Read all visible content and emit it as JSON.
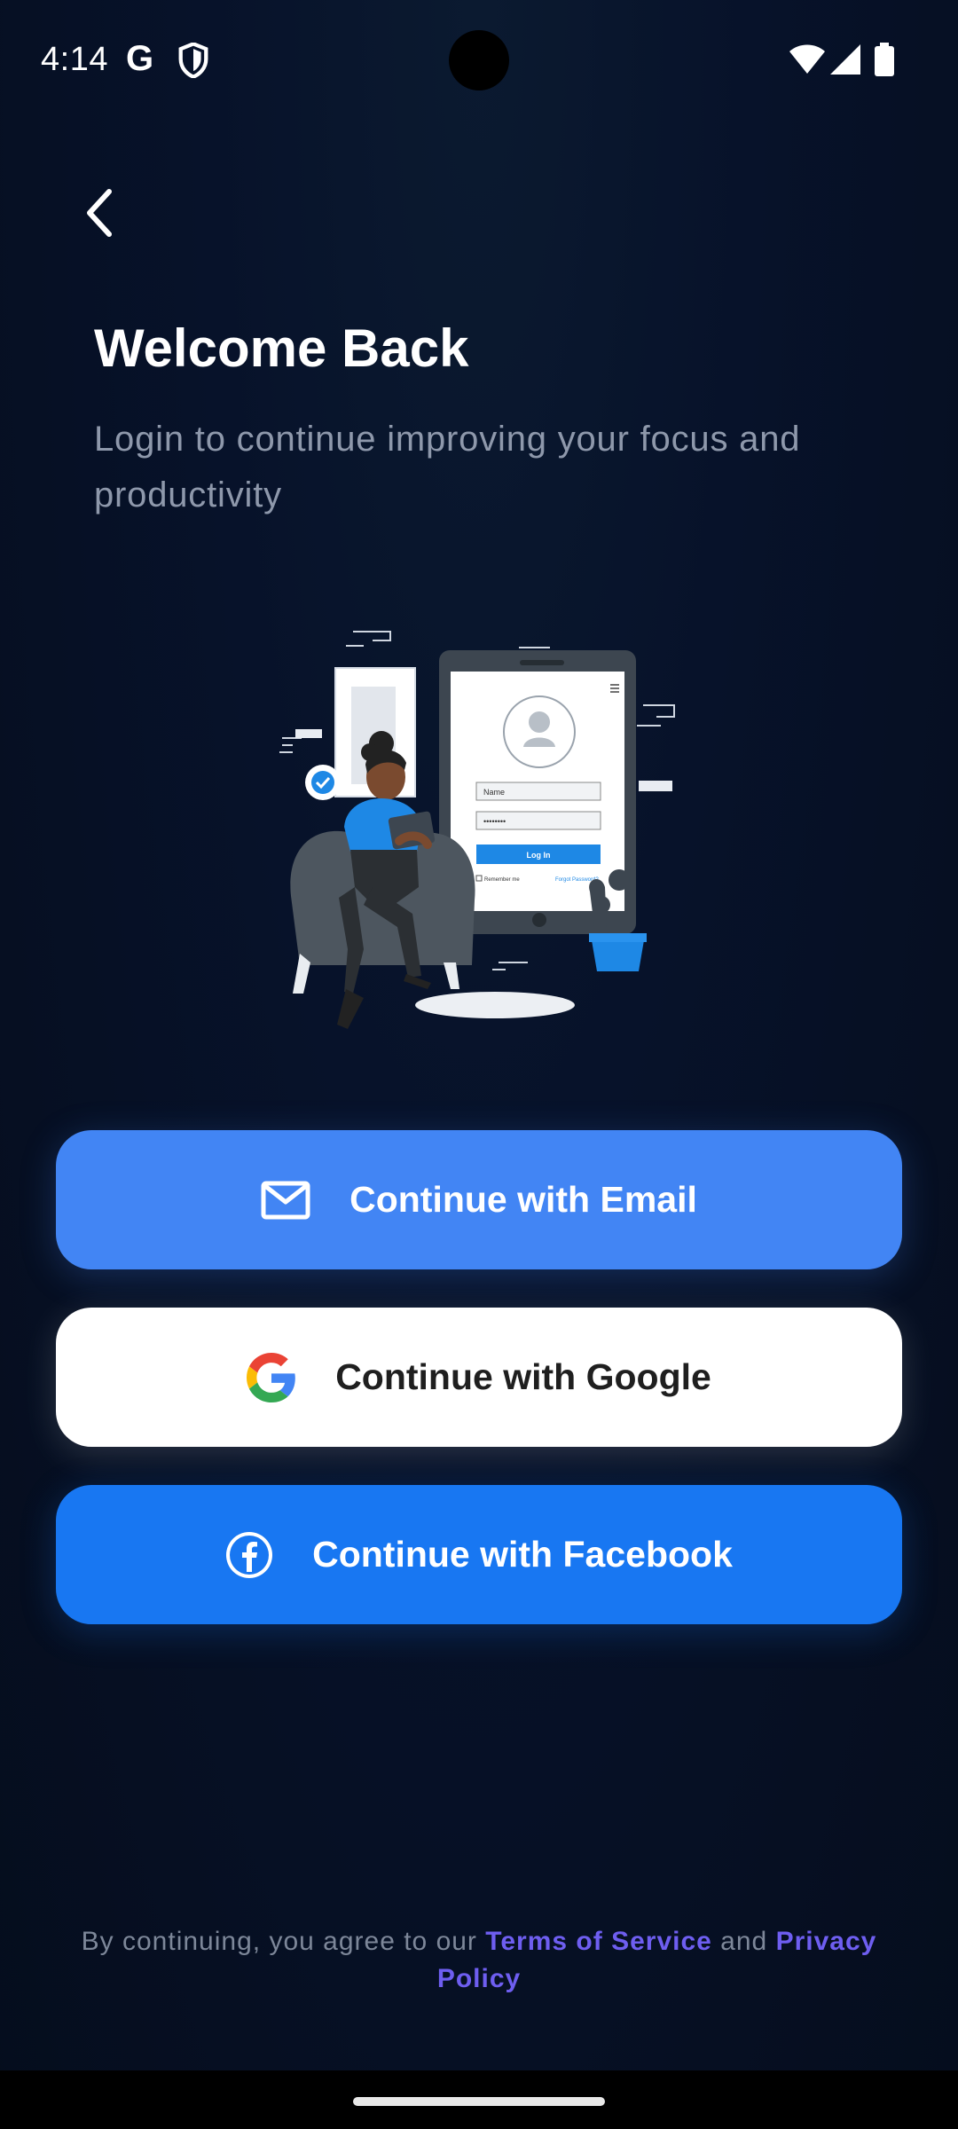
{
  "status_bar": {
    "time": "4:14",
    "google_indicator": "G",
    "icons": [
      "google-icon",
      "shield-icon",
      "wifi-icon",
      "signal-icon",
      "battery-icon"
    ]
  },
  "header": {
    "back_icon": "chevron-left-icon",
    "title": "Welcome Back",
    "subtitle": "Login to continue improving your focus and productivity"
  },
  "illustration": {
    "name_field": "Name",
    "password_field": "••••••••",
    "login_button": "Log In",
    "remember_me": "Remember me",
    "forgot_password": "Forgot Password?"
  },
  "buttons": {
    "email": {
      "label": "Continue with Email",
      "icon": "mail-icon",
      "color": "#4285f4"
    },
    "google": {
      "label": "Continue with Google",
      "icon": "google-logo-icon",
      "color": "#ffffff"
    },
    "facebook": {
      "label": "Continue with Facebook",
      "icon": "facebook-icon",
      "color": "#1877f2"
    }
  },
  "footer": {
    "prefix": "By continuing, you agree to our ",
    "terms": "Terms of Service",
    "middle": " and ",
    "privacy": "Privacy Policy",
    "link_color": "#6e5ef0"
  },
  "colors": {
    "background": "#07122a",
    "subtitle": "#8e98ab"
  }
}
